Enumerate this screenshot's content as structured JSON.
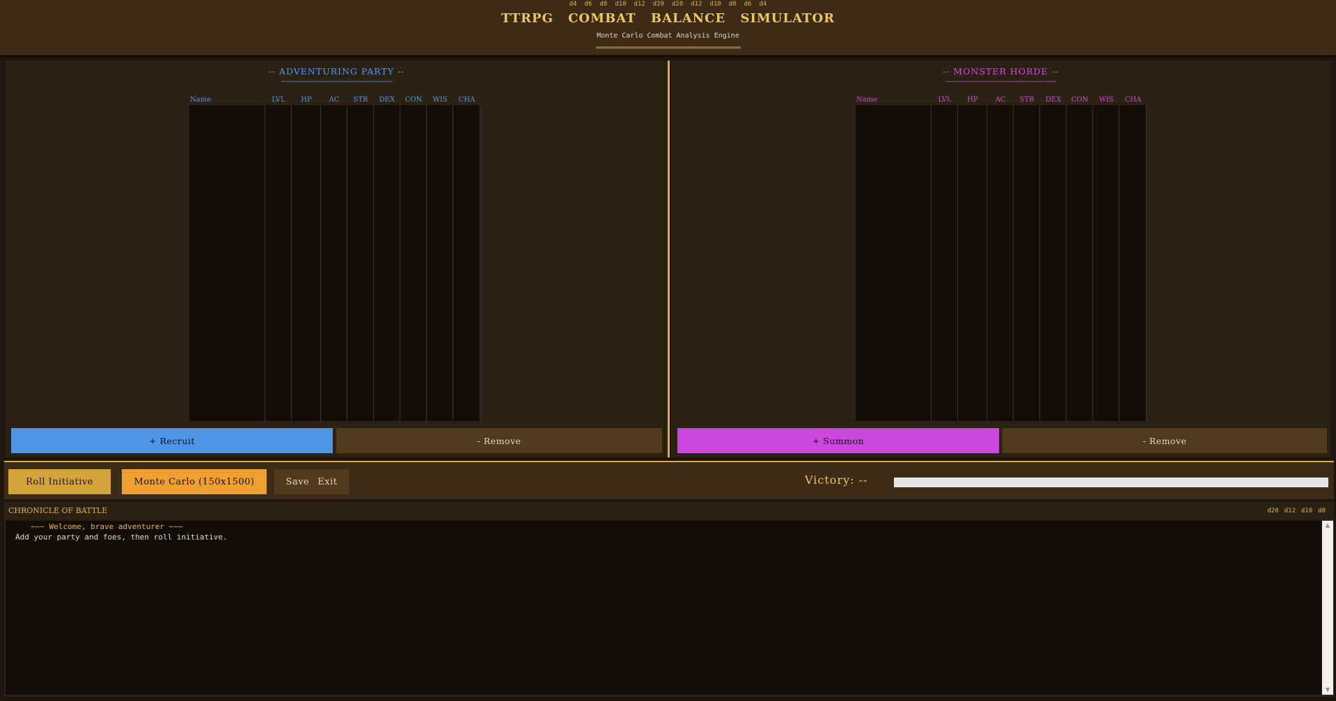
{
  "header": {
    "dice": [
      "d4",
      "d6",
      "d8",
      "d10",
      "d12",
      "d20",
      "d20",
      "d12",
      "d10",
      "d8",
      "d6",
      "d4"
    ],
    "title": "TTRPG COMBAT BALANCE SIMULATOR",
    "subtitle": "Monte Carlo Combat Analysis Engine",
    "rule": "==============================================="
  },
  "party": {
    "title": "-- ADVENTURING PARTY --",
    "squiggle": "~~~~~~~~~~~~~~~~~~~~~~~~~~~~~~~~~~~~",
    "columns": [
      "Name",
      "LVL",
      "HP",
      "AC",
      "STR",
      "DEX",
      "CON",
      "WIS",
      "CHA"
    ],
    "add_label": "+ Recruit",
    "remove_label": "- Remove"
  },
  "horde": {
    "title": "-- MONSTER HORDE --",
    "squiggle": "~~~~~~~~~~~~~~~~~~~~~~~~~~~~~~~~~~~~",
    "columns": [
      "Name",
      "LVL",
      "HP",
      "AC",
      "STR",
      "DEX",
      "CON",
      "WIS",
      "CHA"
    ],
    "add_label": "+ Summon",
    "remove_label": "- Remove"
  },
  "controls": {
    "roll_label": "Roll Initiative",
    "monte_label": "Monte Carlo (150x1500)",
    "save_label": "Save",
    "exit_label": "Exit",
    "victory_label": "Victory: --",
    "victory_progress": 0
  },
  "log": {
    "title": "CHRONICLE OF BATTLE",
    "dice": [
      "d20",
      "d12",
      "d10",
      "d8"
    ],
    "welcome": "~~~ Welcome, brave adventurer ~~~",
    "line1": "Add your party and foes, then roll initiative."
  },
  "colors": {
    "party_accent": "#5797e8",
    "horde_accent": "#cf4ed9",
    "gold": "#f0c65a",
    "background": "#2b2115"
  }
}
